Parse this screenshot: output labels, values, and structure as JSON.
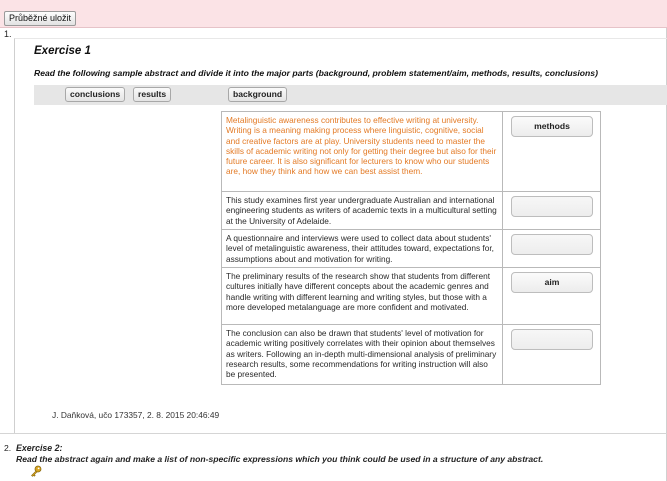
{
  "toolbar": {
    "save_label": "Průběžné uložit"
  },
  "question1": {
    "number": "1.",
    "title": "Exercise 1",
    "instruction": "Read the following sample abstract and divide it into the major parts (background, problem statement/aim, methods, results, conclusions)"
  },
  "bank": {
    "chips": [
      "conclusions",
      "results",
      "background"
    ]
  },
  "rows": [
    {
      "text": "Metalinguistic awareness contributes to effective writing at university. Writing is a meaning making process where linguistic, cognitive, social and creative factors are at play. University students need to master the skills of academic writing not only for getting their degree but also for their future career. It is also significant for lecturers to know who our students are, how they think and how we can best assist them.",
      "answer": "methods",
      "color": "#e37a25"
    },
    {
      "text": "This study examines first year undergraduate Australian and international engineering students as writers of academic texts in a multicultural setting at the University of Adelaide.",
      "answer": "",
      "color": "#2a2a2a"
    },
    {
      "text": "A questionnaire and interviews were used to collect data about students' level of metalinguistic awareness, their attitudes toward, expectations for, assumptions about and motivation for writing.",
      "answer": "",
      "color": "#2a2a2a"
    },
    {
      "text": "The preliminary results of the research show that students from different cultures initially have different concepts about the academic genres and handle writing with different learning and writing styles, but those with a more developed metalanguage are more confident and motivated.",
      "answer": "aim",
      "color": "#2a2a2a"
    },
    {
      "text": "The conclusion can also be drawn that students' level of motivation for academic writing positively correlates with their opinion about themselves as writers. Following an in-depth multi-dimensional analysis of preliminary research results, some recommendations for writing instruction will also be presented.",
      "answer": "",
      "color": "#2a2a2a"
    }
  ],
  "meta": {
    "line": "J. Daňková, učo 173357, 2. 8. 2015 20:46:49"
  },
  "question2": {
    "number": "2.",
    "title": "Exercise 2:",
    "instruction": "Read the abstract again and make a list of non-specific expressions which you think could be used in a structure of any abstract.",
    "icon": "key-icon"
  }
}
